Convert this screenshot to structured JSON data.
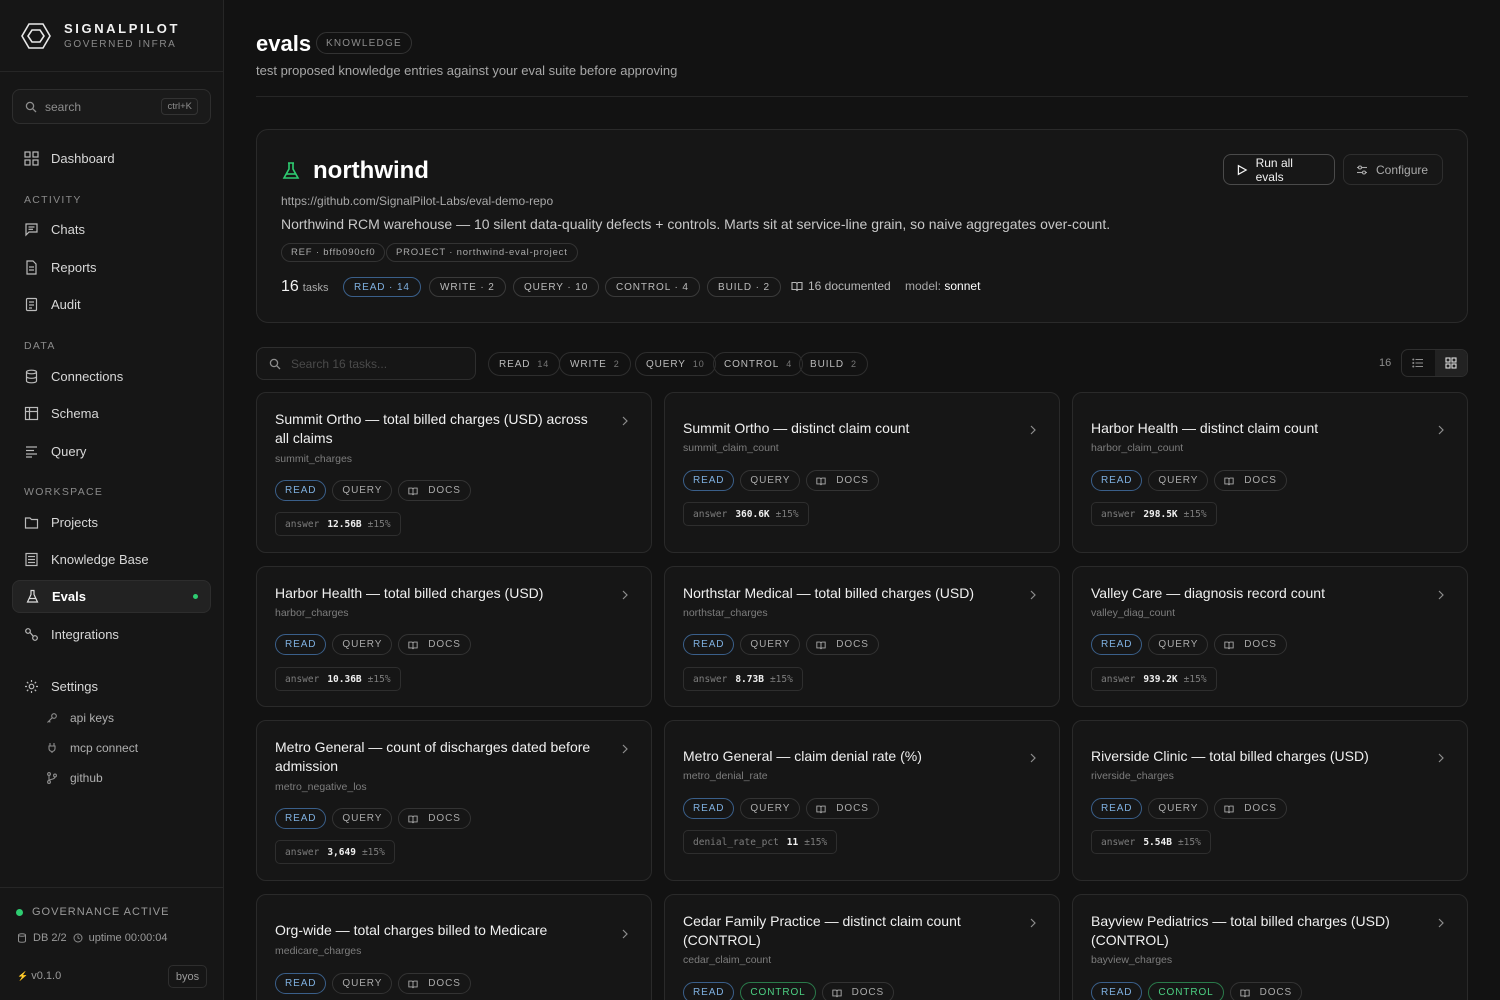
{
  "brand": {
    "name": "SIGNALPILOT",
    "sub": "GOVERNED INFRA"
  },
  "sidebar": {
    "search_placeholder": "search",
    "search_kbd": "ctrl+K",
    "dashboard": "Dashboard",
    "sections": {
      "activity": "ACTIVITY",
      "data": "DATA",
      "workspace": "WORKSPACE"
    },
    "activity": [
      "Chats",
      "Reports",
      "Audit"
    ],
    "data": [
      "Connections",
      "Schema",
      "Query"
    ],
    "workspace": [
      "Projects",
      "Knowledge Base",
      "Evals",
      "Integrations"
    ],
    "settings": "Settings",
    "settings_sub": [
      "api keys",
      "mcp connect",
      "github"
    ],
    "footer": {
      "governance": "GOVERNANCE ACTIVE",
      "db": "DB 2/2",
      "uptime": "uptime 00:00:04",
      "version": "v0.1.0",
      "byos": "byos"
    }
  },
  "page": {
    "title": "evals",
    "tag": "KNOWLEDGE",
    "subtitle": "test proposed knowledge entries against your eval suite before approving"
  },
  "project": {
    "name": "northwind",
    "url": "https://github.com/SignalPilot-Labs/eval-demo-repo",
    "description": "Northwind RCM warehouse — 10 silent data-quality defects + controls. Marts sit at service-line grain, so naive aggregates over-count.",
    "ref_label": "REF · bffb090cf0",
    "project_label": "PROJECT · northwind-eval-project",
    "tasks_count": "16",
    "tasks_label": "tasks",
    "counts": [
      "READ · 14",
      "WRITE · 2",
      "QUERY · 10",
      "CONTROL · 4",
      "BUILD · 2"
    ],
    "documented": "16 documented",
    "model_label": "model:",
    "model": "sonnet",
    "run_button": "Run all evals",
    "configure_button": "Configure"
  },
  "filters": {
    "search_placeholder": "Search 16 tasks...",
    "chips": [
      {
        "label": "READ",
        "count": "14"
      },
      {
        "label": "WRITE",
        "count": "2"
      },
      {
        "label": "QUERY",
        "count": "10"
      },
      {
        "label": "CONTROL",
        "count": "4"
      },
      {
        "label": "BUILD",
        "count": "2"
      }
    ],
    "count": "16"
  },
  "tasks": [
    {
      "title": "Summit Ortho — total billed charges (USD) across all claims",
      "slug": "summit_charges",
      "tags": [
        "READ",
        "QUERY",
        "DOCS"
      ],
      "ans_key": "answer",
      "ans_val": "12.56B",
      "tol": "±15%"
    },
    {
      "title": "Summit Ortho — distinct claim count",
      "slug": "summit_claim_count",
      "tags": [
        "READ",
        "QUERY",
        "DOCS"
      ],
      "ans_key": "answer",
      "ans_val": "360.6K",
      "tol": "±15%"
    },
    {
      "title": "Harbor Health — distinct claim count",
      "slug": "harbor_claim_count",
      "tags": [
        "READ",
        "QUERY",
        "DOCS"
      ],
      "ans_key": "answer",
      "ans_val": "298.5K",
      "tol": "±15%"
    },
    {
      "title": "Harbor Health — total billed charges (USD)",
      "slug": "harbor_charges",
      "tags": [
        "READ",
        "QUERY",
        "DOCS"
      ],
      "ans_key": "answer",
      "ans_val": "10.36B",
      "tol": "±15%"
    },
    {
      "title": "Northstar Medical — total billed charges (USD)",
      "slug": "northstar_charges",
      "tags": [
        "READ",
        "QUERY",
        "DOCS"
      ],
      "ans_key": "answer",
      "ans_val": "8.73B",
      "tol": "±15%"
    },
    {
      "title": "Valley Care — diagnosis record count",
      "slug": "valley_diag_count",
      "tags": [
        "READ",
        "QUERY",
        "DOCS"
      ],
      "ans_key": "answer",
      "ans_val": "939.2K",
      "tol": "±15%"
    },
    {
      "title": "Metro General — count of discharges dated before admission",
      "slug": "metro_negative_los",
      "tags": [
        "READ",
        "QUERY",
        "DOCS"
      ],
      "ans_key": "answer",
      "ans_val": "3,649",
      "tol": "±15%"
    },
    {
      "title": "Metro General — claim denial rate (%)",
      "slug": "metro_denial_rate",
      "tags": [
        "READ",
        "QUERY",
        "DOCS"
      ],
      "ans_key": "denial_rate_pct",
      "ans_val": "11",
      "tol": "±15%"
    },
    {
      "title": "Riverside Clinic — total billed charges (USD)",
      "slug": "riverside_charges",
      "tags": [
        "READ",
        "QUERY",
        "DOCS"
      ],
      "ans_key": "answer",
      "ans_val": "5.54B",
      "tol": "±15%"
    },
    {
      "title": "Org-wide — total charges billed to Medicare",
      "slug": "medicare_charges",
      "tags": [
        "READ",
        "QUERY",
        "DOCS"
      ]
    },
    {
      "title": "Cedar Family Practice — distinct claim count (CONTROL)",
      "slug": "cedar_claim_count",
      "tags": [
        "READ",
        "CONTROL",
        "DOCS"
      ]
    },
    {
      "title": "Bayview Pediatrics — total billed charges (USD) (CONTROL)",
      "slug": "bayview_charges",
      "tags": [
        "READ",
        "CONTROL",
        "DOCS"
      ]
    }
  ]
}
